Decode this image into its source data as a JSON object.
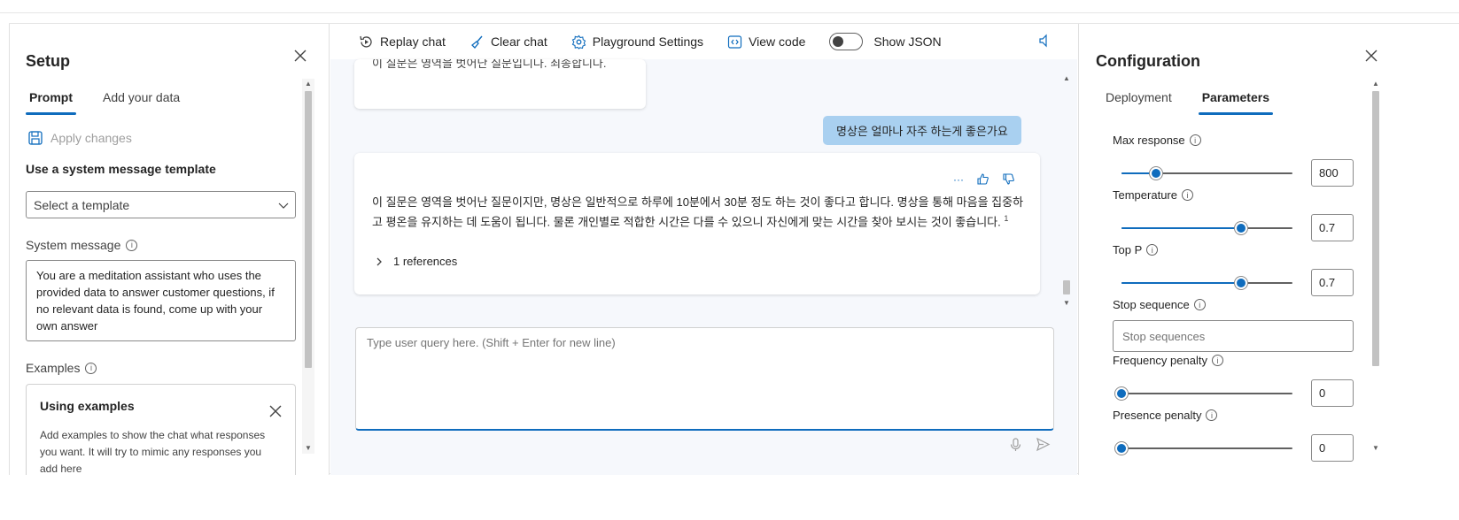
{
  "setup": {
    "title": "Setup",
    "tabs": [
      {
        "label": "Prompt",
        "active": true
      },
      {
        "label": "Add your data",
        "active": false
      }
    ],
    "apply_label": "Apply changes",
    "template_heading": "Use a system message template",
    "template_select": "Select a template",
    "system_message_label": "System message",
    "system_message": "You are a meditation assistant who uses the provided data to answer customer questions, if no relevant data is found, come up with your own answer",
    "examples_label": "Examples",
    "examples_card": {
      "title": "Using examples",
      "desc": "Add examples to show the chat what responses you want. It will try to mimic any responses you add here"
    }
  },
  "toolbar": {
    "replay": "Replay chat",
    "clear": "Clear chat",
    "settings": "Playground Settings",
    "view_code": "View code",
    "show_json": "Show JSON",
    "show_json_on": false
  },
  "chat": {
    "prev_fragment": "이 질문은 영역을 벗어난 질문입니다. 죄송합니다.",
    "user_message": "명상은 얼마나 자주 하는게 좋은가요",
    "assistant_message": "이 질문은 영역을 벗어난 질문이지만, 명상은 일반적으로 하루에 10분에서 30분 정도 하는 것이 좋다고 합니다. 명상을 통해 마음을 집중하고 평온을 유지하는 데 도움이 됩니다. 물론 개인별로 적합한 시간은 다를 수 있으니 자신에게 맞는 시간을 찾아 보시는 것이 좋습니다.",
    "citation": "1",
    "more_label": "···",
    "references": "1 references",
    "input_placeholder": "Type user query here. (Shift + Enter for new line)"
  },
  "config": {
    "title": "Configuration",
    "tabs": [
      {
        "label": "Deployment",
        "active": false
      },
      {
        "label": "Parameters",
        "active": true
      }
    ],
    "params": {
      "max_response": {
        "label": "Max response",
        "value": "800",
        "fraction": 0.2
      },
      "temperature": {
        "label": "Temperature",
        "value": "0.7",
        "fraction": 0.7
      },
      "top_p": {
        "label": "Top P",
        "value": "0.7",
        "fraction": 0.7
      },
      "stop_sequence": {
        "label": "Stop sequence",
        "placeholder": "Stop sequences"
      },
      "frequency_penalty": {
        "label": "Frequency penalty",
        "value": "0",
        "fraction": 0
      },
      "presence_penalty": {
        "label": "Presence penalty",
        "value": "0",
        "fraction": 0
      }
    }
  },
  "colors": {
    "accent": "#0f6cbd",
    "user_bubble": "#a9d0f0",
    "chat_bg": "#f6f8fc"
  }
}
